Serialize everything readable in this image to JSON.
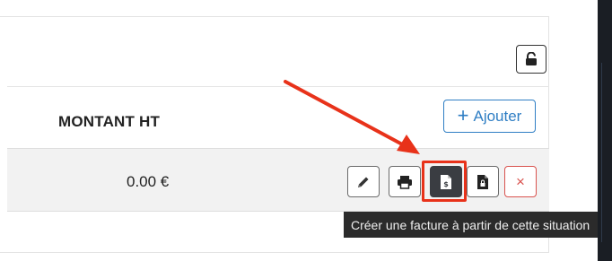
{
  "toolbar": {
    "lock_icon": "unlock-icon"
  },
  "table": {
    "column_header": "MONTANT HT",
    "add_button": {
      "icon": "plus-icon",
      "label": "Ajouter"
    },
    "rows": [
      {
        "amount": "0.00 €"
      }
    ]
  },
  "row_actions": {
    "edit_icon": "pencil-icon",
    "print_icon": "printer-icon",
    "invoice_icon": "invoice-dollar-icon",
    "doc_icon": "document-lock-icon",
    "delete_label": "×"
  },
  "tooltip": {
    "text": "Créer une facture à partir de cette situation"
  },
  "annotation": {
    "arrow_color": "#e8321a",
    "highlight_color": "#e8321a"
  },
  "colors": {
    "accent": "#2f7ec4",
    "danger": "#d9534f"
  }
}
